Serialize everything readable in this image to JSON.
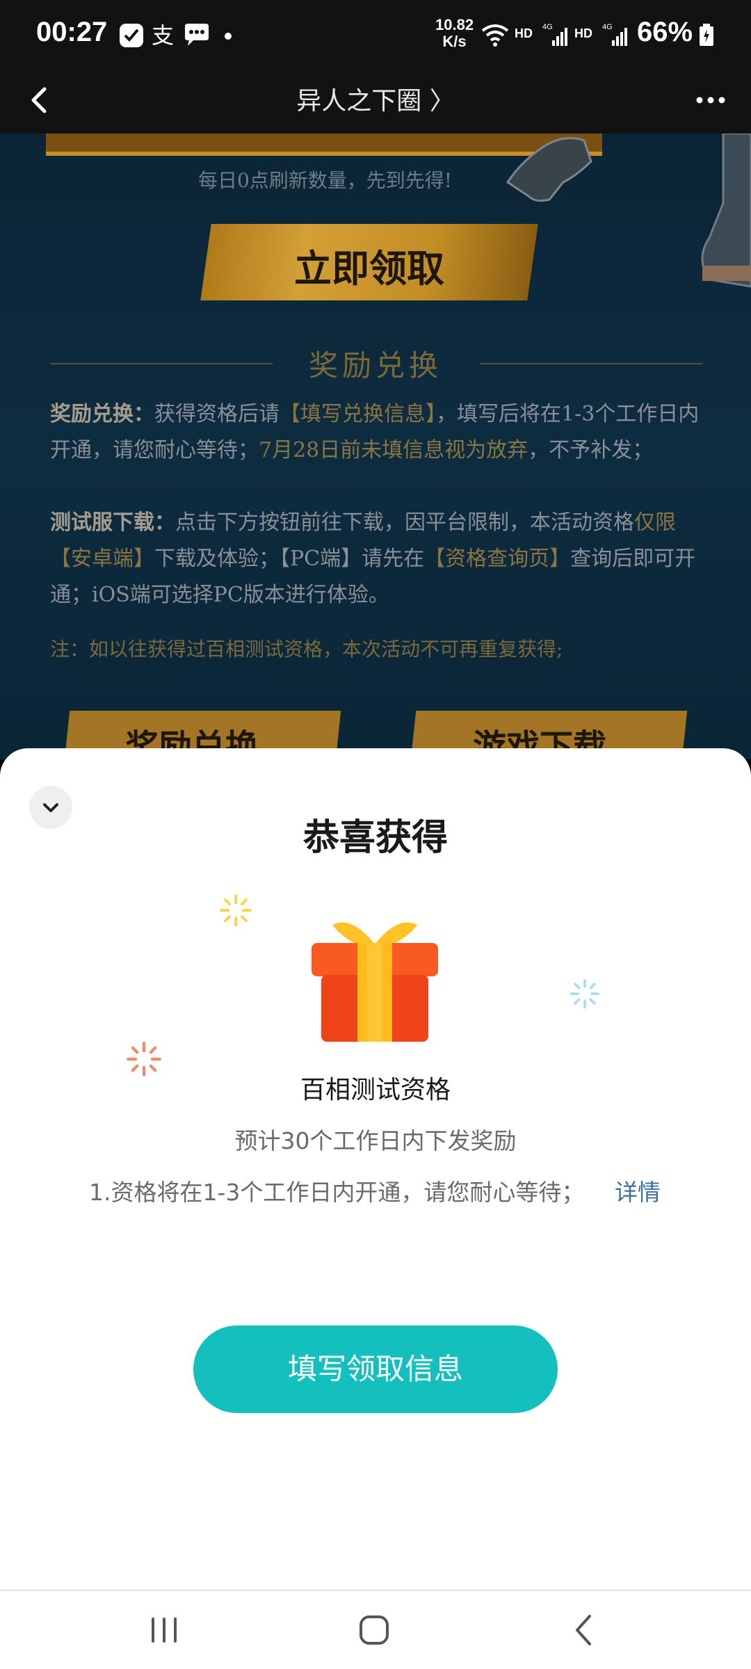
{
  "status_bar": {
    "time": "00:27",
    "net_speed_value": "10.82",
    "net_speed_unit": "K/s",
    "hd1": "HD",
    "hd2": "HD",
    "battery": "66%"
  },
  "nav": {
    "title": "异人之下圈 〉"
  },
  "background_page": {
    "refresh_note": "每日0点刷新数量，先到先得!",
    "claim_button": "立即领取",
    "section_title": "奖励兑换",
    "para1_label": "奖励兑换：",
    "para1_text_a": "获得资格后请",
    "para1_hl_a": "【填写兑换信息】",
    "para1_text_b": "，填写后将在1-3个工作日内开通，请您耐心等待；",
    "para1_hl_b": "7月28日前未填信息视为放弃",
    "para1_text_c": "，不予补发；",
    "para2_label": "测试服下载：",
    "para2_text_a": "点击下方按钮前往下载，因平台限制，本活动资格",
    "para2_hl_a": "仅限【安卓端】",
    "para2_text_b": "下载及体验；【PC端】请先在",
    "para2_hl_b": "【资格查询页】",
    "para2_text_c": "查询后即可开通；iOS端可选择PC版本进行体验。",
    "note": "注：如以往获得过百相测试资格，本次活动不可再重复获得;",
    "btn_left": "奖励兑换",
    "btn_right": "游戏下载"
  },
  "sheet": {
    "title": "恭喜获得",
    "prize_name": "百相测试资格",
    "eta": "预计30个工作日内下发奖励",
    "description": "1.资格将在1-3个工作日内开通，请您耐心等待；",
    "details_link": "详情",
    "fill_button": "填写领取信息"
  },
  "colors": {
    "accent": "#13c0bd",
    "link": "#3e6fa4",
    "gift_box": "#f5481e",
    "gift_ribbon": "#ffb81c"
  },
  "icons": {
    "back": "chevron-left-icon",
    "more": "more-dots-icon",
    "collapse": "chevron-down-icon",
    "gift": "gift-box-icon"
  }
}
